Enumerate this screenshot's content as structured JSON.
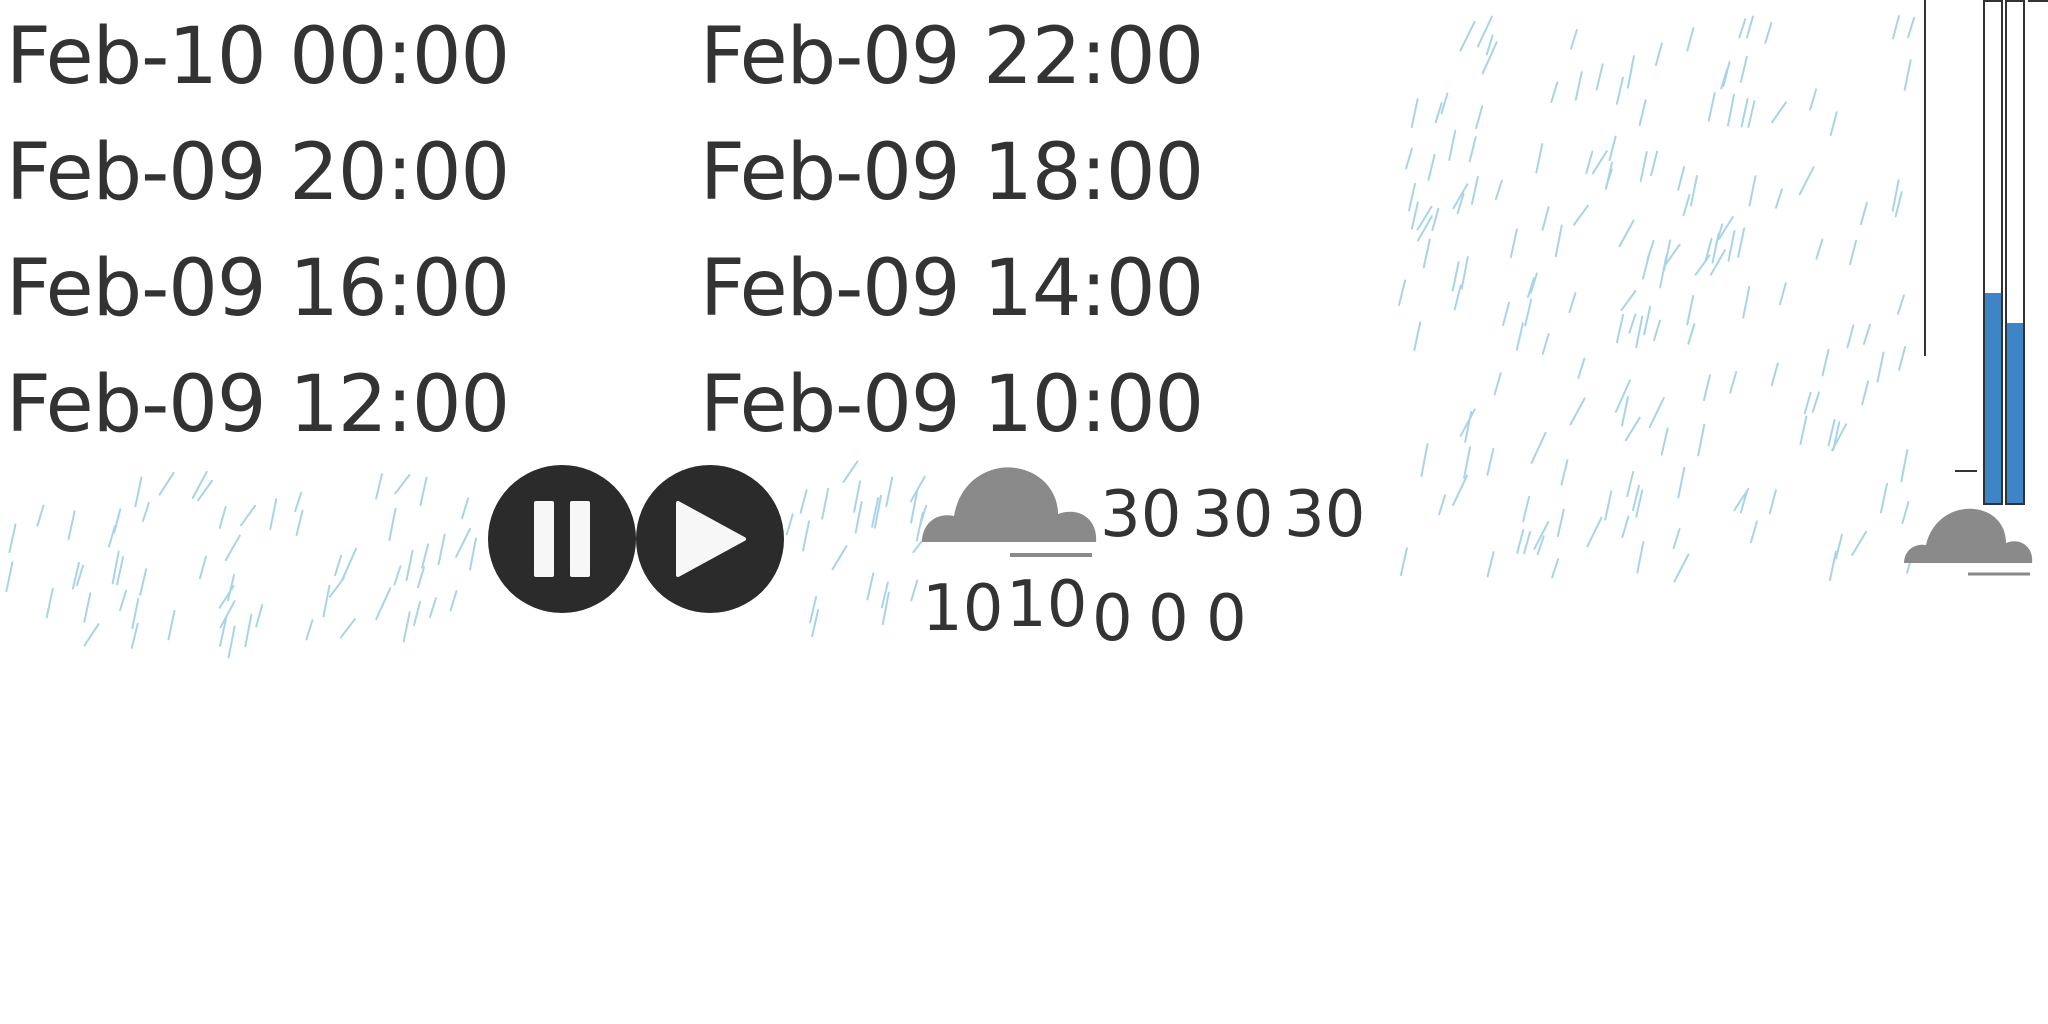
{
  "time_labels": [
    "Feb-10 00:00",
    "Feb-09 22:00",
    "Feb-09 20:00",
    "Feb-09 18:00",
    "Feb-09 16:00",
    "Feb-09 14:00",
    "Feb-09 12:00",
    "Feb-09 10:00"
  ],
  "controls": {
    "pause_icon": "pause-icon",
    "play_icon": "play-icon",
    "button_color": "#2b2b2b"
  },
  "cloud_readout": {
    "icon": "cloud-icon",
    "top_values": [
      "30",
      "30",
      "30"
    ],
    "bottom_values": [
      "10",
      "10",
      "0",
      "0",
      "0"
    ]
  },
  "gauges": {
    "fill_color": "#3d85c6",
    "bar_1_level": 0.42,
    "bar_2_level": 0.36
  },
  "colors": {
    "rain": "#a8d4ea",
    "cloud": "#8a8a8a",
    "text": "#333333"
  }
}
